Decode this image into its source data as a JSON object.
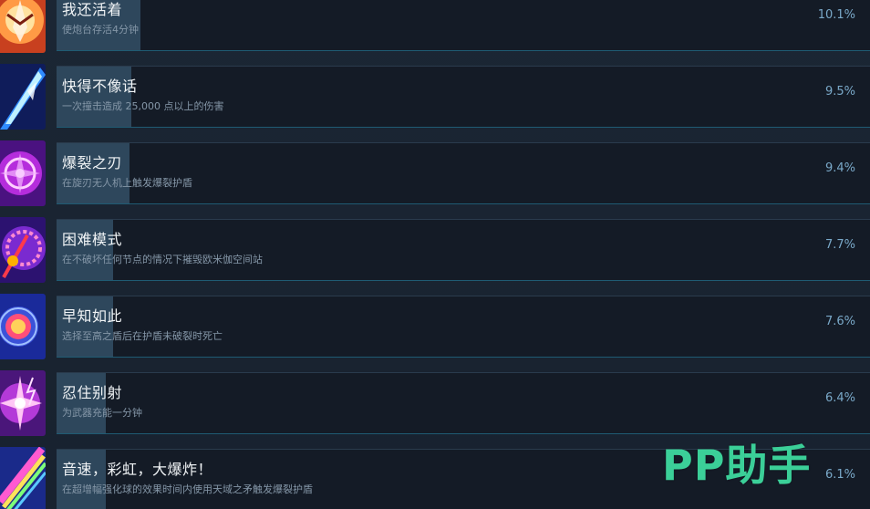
{
  "achievements": [
    {
      "title": "我还活着",
      "desc": "使炮台存活4分钟",
      "pct": "10.1%",
      "percent": 10.1,
      "icon": "turret-icon",
      "colors": [
        "#ffb15c",
        "#e0562a",
        "#b8331f"
      ]
    },
    {
      "title": "快得不像话",
      "desc": "一次撞击造成 25,000 点以上的伤害",
      "pct": "9.5%",
      "percent": 9.5,
      "icon": "blue-streak-icon",
      "colors": [
        "#c9f3ff",
        "#2f8bff",
        "#1a2a8c"
      ]
    },
    {
      "title": "爆裂之刃",
      "desc": "在旋刃无人机上触发爆裂护盾",
      "pct": "9.4%",
      "percent": 9.4,
      "icon": "blade-drone-icon",
      "colors": [
        "#ffb3ff",
        "#c030e0",
        "#5a1790"
      ]
    },
    {
      "title": "困难模式",
      "desc": "在不破坏任何节点的情况下摧毁欧米伽空间站",
      "pct": "7.7%",
      "percent": 7.7,
      "icon": "station-icon",
      "colors": [
        "#ff7aa0",
        "#7a2ad0",
        "#3a1480"
      ]
    },
    {
      "title": "早知如此",
      "desc": "选择至高之盾后在护盾未破裂时死亡",
      "pct": "7.6%",
      "percent": 7.6,
      "icon": "shield-burst-icon",
      "colors": [
        "#ffd15a",
        "#ff4f7a",
        "#2a3bb0"
      ]
    },
    {
      "title": "忍住别射",
      "desc": "为武器充能一分钟",
      "pct": "6.4%",
      "percent": 6.4,
      "icon": "charge-weapon-icon",
      "colors": [
        "#ffffff",
        "#e94fd8",
        "#5a1b8a"
      ]
    },
    {
      "title": "音速，彩虹，大爆炸！",
      "desc": "在超增幅强化球的效果时间内使用天域之矛触发爆裂护盾",
      "pct": "6.1%",
      "percent": 6.1,
      "icon": "rainbow-spear-icon",
      "colors": [
        "#7dff7a",
        "#ff5ad1",
        "#3a6bff"
      ]
    }
  ],
  "watermark": "PP助手"
}
